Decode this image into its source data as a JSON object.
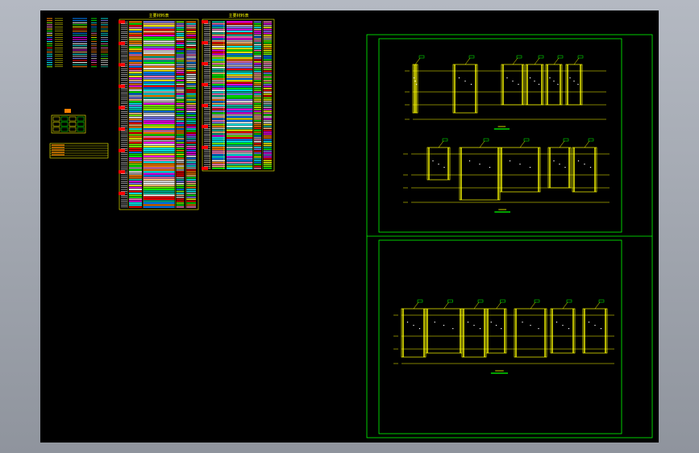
{
  "canvas": {
    "background": "#000000",
    "frame_color": "#00ff00",
    "line_color": "#ffff00"
  },
  "tables": [
    {
      "title": "主要材料表",
      "color": "#ffff00"
    },
    {
      "title": "主要材料表",
      "color": "#ffff00"
    }
  ],
  "drawings": [
    {
      "caption": "",
      "color": "#ffff00"
    },
    {
      "caption": "",
      "color": "#ffff00"
    },
    {
      "caption": "",
      "color": "#ffff00"
    }
  ],
  "palette": [
    "#ff0000",
    "#00ff00",
    "#ffff00",
    "#00ffff",
    "#ff00ff",
    "#ffffff",
    "#ff8000",
    "#0080ff",
    "#80ff00",
    "#ff80c0",
    "#c0c0c0",
    "#ffc080",
    "#8080ff",
    "#00c0a0"
  ]
}
